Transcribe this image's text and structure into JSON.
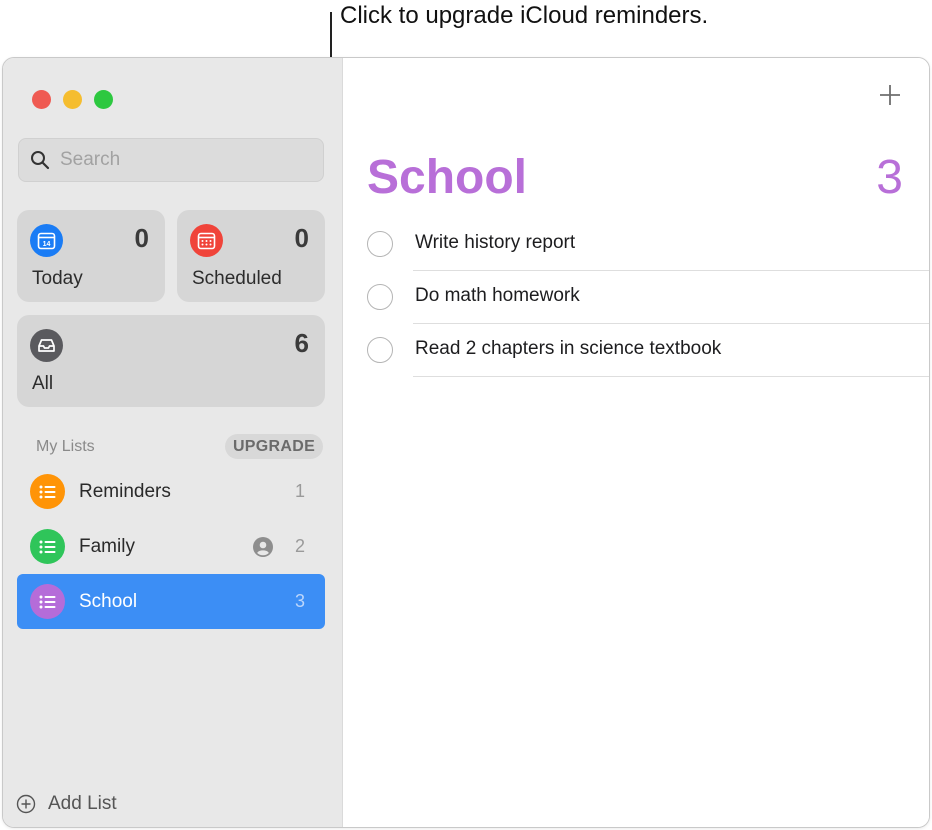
{
  "callout": {
    "text": "Click to upgrade iCloud reminders."
  },
  "window": {
    "traffic_lights": [
      "#ef5a52",
      "#f5bd2f",
      "#2dc840"
    ]
  },
  "sidebar": {
    "search": {
      "placeholder": "Search",
      "icon": "search-icon"
    },
    "smart_lists": {
      "today": {
        "label": "Today",
        "count": "0",
        "icon": "calendar-today-icon",
        "color": "#1a7cf5",
        "icon_text": "14"
      },
      "scheduled": {
        "label": "Scheduled",
        "count": "0",
        "icon": "calendar-scheduled-icon",
        "color": "#f0443a"
      },
      "all": {
        "label": "All",
        "count": "6",
        "icon": "tray-icon",
        "color": "#5a5a5e"
      }
    },
    "my_lists": {
      "header": "My Lists",
      "upgrade_label": "UPGRADE",
      "items": [
        {
          "name": "Reminders",
          "count": "1",
          "color": "#ff9407",
          "icon": "list-icon"
        },
        {
          "name": "Family",
          "count": "2",
          "color": "#2fc55a",
          "icon": "list-icon",
          "shared": true
        },
        {
          "name": "School",
          "count": "3",
          "color": "#b56cd9",
          "icon": "list-icon",
          "selected": true
        }
      ]
    },
    "add_list_label": "Add List"
  },
  "main": {
    "title": "School",
    "count": "3",
    "accent_color": "#b86fd8",
    "tasks": [
      {
        "text": "Write history report"
      },
      {
        "text": "Do math homework"
      },
      {
        "text": "Read 2 chapters in science textbook"
      }
    ]
  }
}
